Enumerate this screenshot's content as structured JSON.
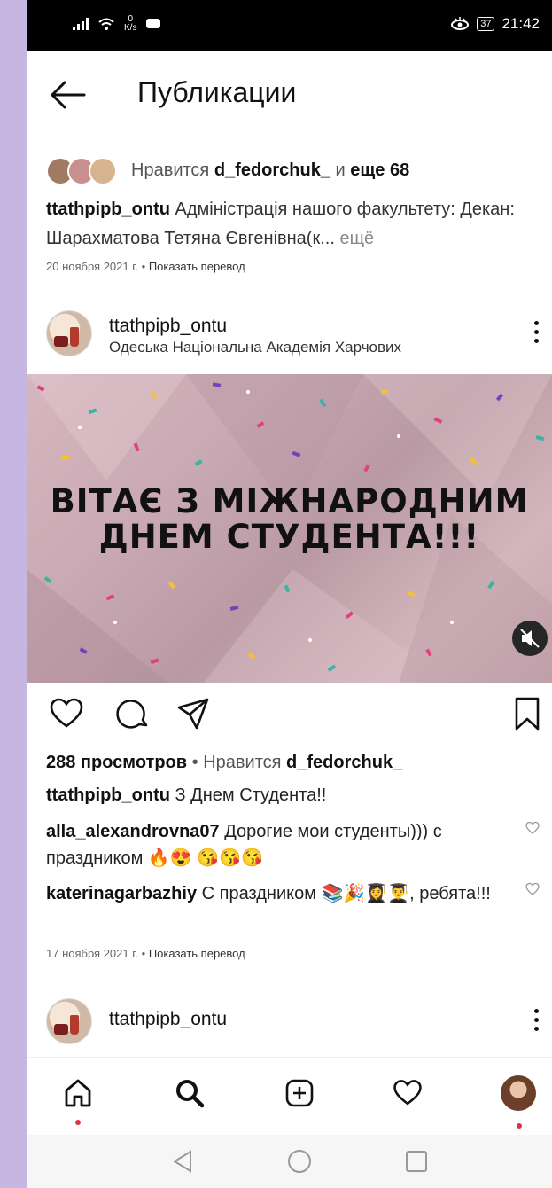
{
  "status_bar": {
    "net_speed_value": "0",
    "net_speed_unit": "K/s",
    "battery": "37",
    "time": "21:42"
  },
  "header": {
    "title": "Публикации"
  },
  "post1_footer": {
    "liked_prefix": "Нравится",
    "liked_user": "d_fedorchuk_",
    "liked_mid": "и",
    "liked_suffix": "еще 68",
    "caption_user": "ttathpipb_ontu",
    "caption_text": "Адміністрація нашого факультету: Декан: Шарахматова Тетяна Євгенівна(к...",
    "more": "ещё",
    "date": "20 ноября 2021 г.",
    "separator": "•",
    "translate": "Показать перевод"
  },
  "post2": {
    "username": "ttathpipb_ontu",
    "location": "Одеська Національна Академія Харчових",
    "media_text_line1": "ВІТАЄ  З МІЖНАРОДНИМ",
    "media_text_line2": "ДНЕМ СТУДЕНТА!!!",
    "views": "288 просмотров",
    "liked_prefix": "Нравится",
    "liked_user": "d_fedorchuk_",
    "caption_user": "ttathpipb_ontu",
    "caption_text": "З Днем Студента!!",
    "comments": [
      {
        "user": "alla_alexandrovna07",
        "text": "Дорогие мои студенты))) с праздником 🔥😍 😘😘😘"
      },
      {
        "user": "katerinagarbazhiy",
        "text": "С праздником 📚🎉👩‍🎓👨‍🎓, ребята!!!"
      }
    ],
    "date": "17 ноября 2021 г.",
    "separator": "•",
    "translate": "Показать перевод"
  },
  "post3": {
    "username": "ttathpipb_ontu"
  },
  "colors": {
    "notification_dot": "#e0304a",
    "side_background": "#c8b6e2"
  },
  "icons": [
    "back-arrow-icon",
    "heart-icon",
    "comment-icon",
    "share-icon",
    "bookmark-icon",
    "more-icon",
    "mute-icon",
    "home-icon",
    "search-icon",
    "new-post-icon",
    "activity-icon",
    "profile-avatar",
    "back-triangle-icon",
    "home-circle-icon",
    "recents-square-icon"
  ]
}
